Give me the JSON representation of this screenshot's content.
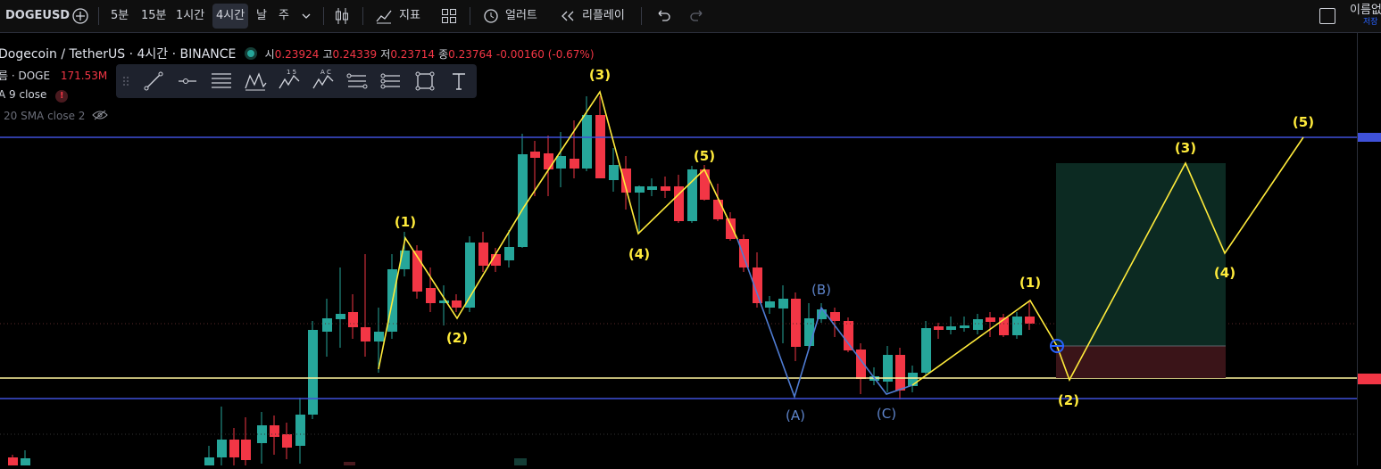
{
  "toolbar": {
    "symbol": "DOGEUSD",
    "intervals": [
      "5분",
      "15분",
      "1시간",
      "4시간",
      "날",
      "주"
    ],
    "active_interval": "4시간",
    "indicators_label": "지표",
    "alert_label": "얼러트",
    "replay_label": "리플레이",
    "layout_name": "이름없",
    "save_label": "저장"
  },
  "legend": {
    "title": "Dogecoin / TetherUS · 4시간 · BINANCE",
    "open_label": "시",
    "open": "0.23924",
    "high_label": "고",
    "high": "0.24339",
    "low_label": "저",
    "low": "0.23714",
    "close_label": "종",
    "close": "0.23764",
    "change": "-0.00160 (-0.67%)",
    "volume_label": "름 · DOGE",
    "volume_value": "171.53M",
    "ma9": "A 9 close",
    "sma20": "20 SMA close 2"
  },
  "wave_labels": {
    "w1": "(1)",
    "w2": "(2)",
    "w3": "(3)",
    "w4": "(4)",
    "w5": "(5)",
    "wA": "(A)",
    "wB": "(B)",
    "wC": "(C)",
    "n1": "(1)",
    "n2": "(2)",
    "n3": "(3)",
    "n4": "(4)",
    "n5": "(5)"
  },
  "colors": {
    "up": "#26a69a",
    "down": "#f23645",
    "wave_line": "#ffeb3b",
    "abc_line": "#4f7cd3",
    "h_line_blue": "#3f51d9",
    "h_line_yellow": "#fff59d",
    "profit_zone": "#0c2a22",
    "loss_zone": "#3a1418"
  }
}
